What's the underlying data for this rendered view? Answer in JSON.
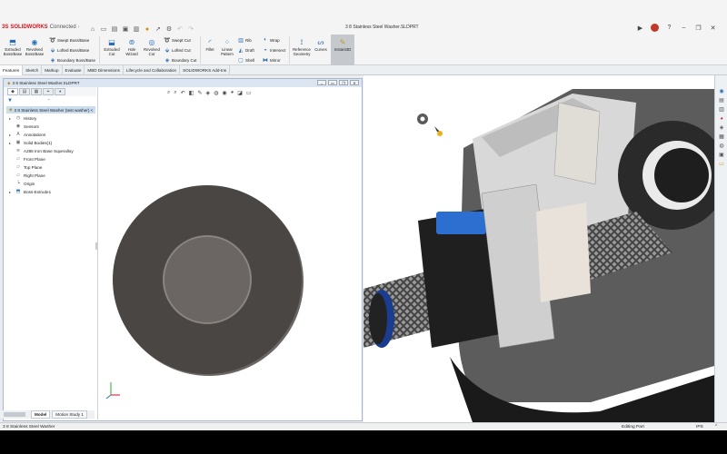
{
  "app": {
    "logo_mark": "3S",
    "logo_name": "SOLIDWORKS",
    "logo_suffix": "Connected",
    "doc_title": "3 8 Stainless Steel Washer.SLDPRT"
  },
  "ribbon": {
    "extruded_boss": "Extruded Boss/Base",
    "revolved_boss": "Revolved Boss/Base",
    "swept_boss": "Swept Boss/Base",
    "lofted_boss": "Lofted Boss/Base",
    "boundary_boss": "Boundary Boss/Base",
    "extruded_cut": "Extruded Cut",
    "hole_wizard": "Hole Wizard",
    "revolved_cut": "Revolved Cut",
    "swept_cut": "Swept Cut",
    "lofted_cut": "Lofted Cut",
    "boundary_cut": "Boundary Cut",
    "fillet": "Fillet",
    "linear_pattern": "Linear Pattern",
    "rib": "Rib",
    "draft": "Draft",
    "shell": "Shell",
    "wrap": "Wrap",
    "intersect": "Intersect",
    "mirror": "Mirror",
    "reference_geometry": "Reference Geometry",
    "curves": "Curves",
    "instant3d": "Instant3D"
  },
  "tabs": [
    "Features",
    "Sketch",
    "Markup",
    "Evaluate",
    "MBD Dimensions",
    "Lifecycle and Collaboration",
    "SOLIDWORKS Add-Ins"
  ],
  "doc_window": {
    "title": "3 8 Stainless Steel Washer.SLDPRT"
  },
  "tree": {
    "root": "3 8 Stainless Steel Washer (test washer) <",
    "items": [
      "History",
      "Sensors",
      "Annotations",
      "Solid Bodies(1)",
      "A286 Iron Base Superalloy",
      "Front Plane",
      "Top Plane",
      "Right Plane",
      "Origin",
      "Boss-Extrude1"
    ]
  },
  "model_tabs": [
    "Model",
    "Motion Study 1"
  ],
  "status": {
    "left": "3 8 Stainless Steel Washer",
    "editing": "Editing Part",
    "units": "IPS"
  },
  "colors": {
    "accent": "#2a6fb5",
    "brand_red": "#d4121e",
    "washer": "#4a4643",
    "instant3d_bg": "#c5c9ce"
  }
}
